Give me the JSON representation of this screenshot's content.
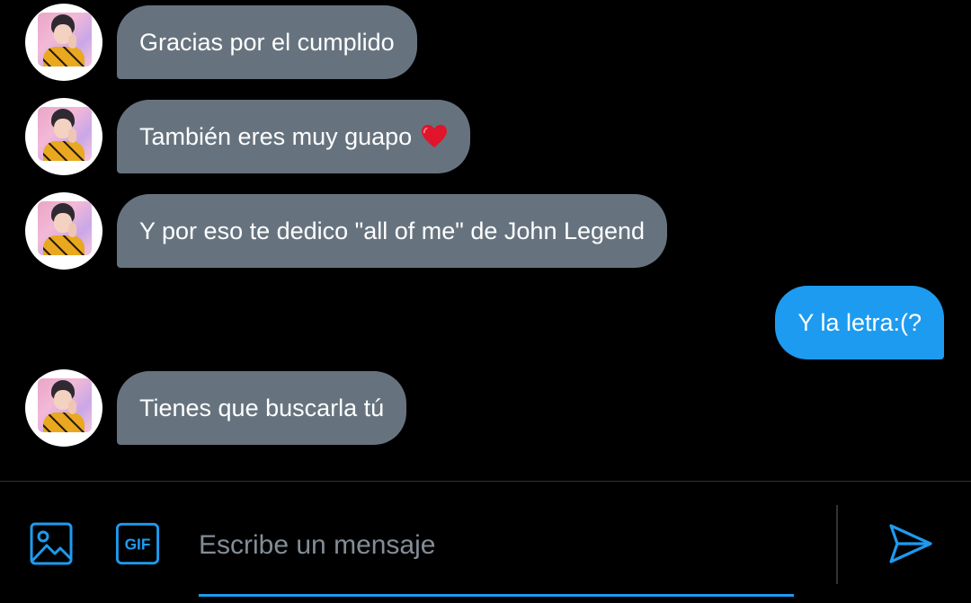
{
  "messages": [
    {
      "direction": "in",
      "text": "Gracias por el cumplido"
    },
    {
      "direction": "in",
      "text": "También eres muy guapo",
      "emoji": "red-heart"
    },
    {
      "direction": "in",
      "text": "Y por eso te dedico \"all of me\" de John Legend"
    },
    {
      "direction": "out",
      "text": "Y la letra:(?"
    },
    {
      "direction": "in",
      "text": "Tienes que buscarla tú"
    }
  ],
  "composer": {
    "placeholder": "Escribe un mensaje",
    "gif_label": "GIF",
    "icons": [
      "image-icon",
      "gif-icon",
      "send-icon"
    ]
  },
  "colors": {
    "background": "#000000",
    "incoming_bubble": "#66737f",
    "outgoing_bubble": "#1d9bf0",
    "accent": "#1d9bf0",
    "placeholder_text": "#848d96"
  }
}
